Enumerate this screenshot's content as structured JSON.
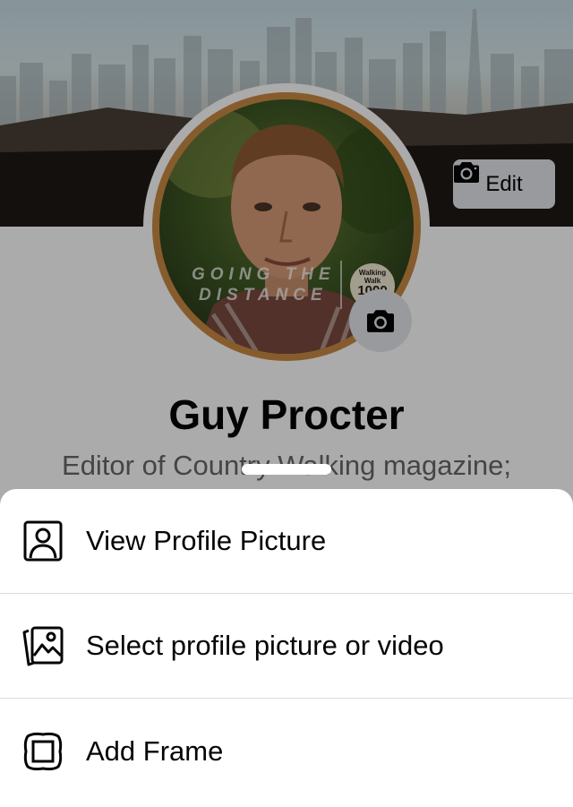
{
  "cover": {
    "edit_label": "Edit"
  },
  "avatar": {
    "frame_line1": "GOING THE",
    "frame_line2": "DISTANCE",
    "badge_top": "Walking Walk",
    "badge_number": "1000",
    "badge_bottom": "miles"
  },
  "profile": {
    "name": "Guy Procter",
    "bio": "Editor of Country Walking magazine;"
  },
  "sheet": {
    "items": [
      {
        "label": "View Profile Picture",
        "icon": "person-portrait-icon"
      },
      {
        "label": "Select profile picture or video",
        "icon": "photo-gallery-icon"
      },
      {
        "label": "Add Frame",
        "icon": "frame-icon"
      }
    ]
  },
  "colors": {
    "frame_orange": "#c98a43",
    "button_gray": "#e4e6eb",
    "text_primary": "#050505",
    "text_secondary": "#65676b",
    "divider": "#dadde1"
  }
}
